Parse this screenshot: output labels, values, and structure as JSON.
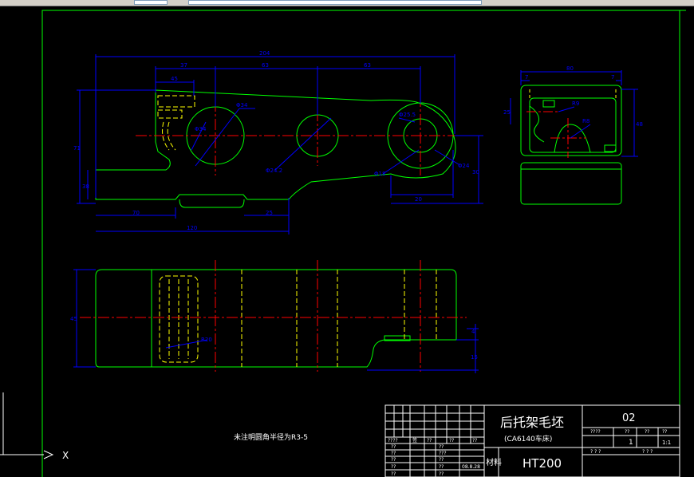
{
  "drawing": {
    "top_view_dims": {
      "overall": "204",
      "seg1": "37",
      "seg2": "63",
      "seg3": "63",
      "left_step": "45",
      "height_total": "71",
      "height_left": "38",
      "right_height": "30",
      "right_width": "20",
      "hole_d1": "Φ34",
      "hole_d2": "Φ34",
      "hole_d3": "Φ24.2",
      "hole_d4": "Φ25.5",
      "hole_d5": "Φ24",
      "r_small": "Φ18",
      "bottom_left": "70",
      "bottom_slot": "25",
      "bottom_total": "120"
    },
    "side_view_dims": {
      "width": "80",
      "left_small": "7",
      "right_small": "7",
      "height_upper": "25",
      "height_total": "48",
      "r1": "R9",
      "r2": "R8"
    },
    "front_view_dims": {
      "height": "45",
      "small_step": "4",
      "bottom": "15",
      "radius_note": "R20"
    },
    "note": "未注明圆角半径为R3-5"
  },
  "title_block": {
    "part_name": "后托架毛坯",
    "machine": "(CA6140车床)",
    "drawing_number": "02",
    "material_label": "材料",
    "material": "HT200",
    "scale": "1:1",
    "quantity": "1",
    "date": "08.8.28",
    "sheet_text_1": "? ? ?",
    "sheet_text_2": "? ? ?"
  },
  "ucs": {
    "x_label": "X"
  },
  "colors": {
    "outline": "#00ff00",
    "dimension": "#0000ff",
    "centerline": "#ff0000",
    "hidden": "#ffff00",
    "border": "#ffffff",
    "background": "#000000"
  }
}
